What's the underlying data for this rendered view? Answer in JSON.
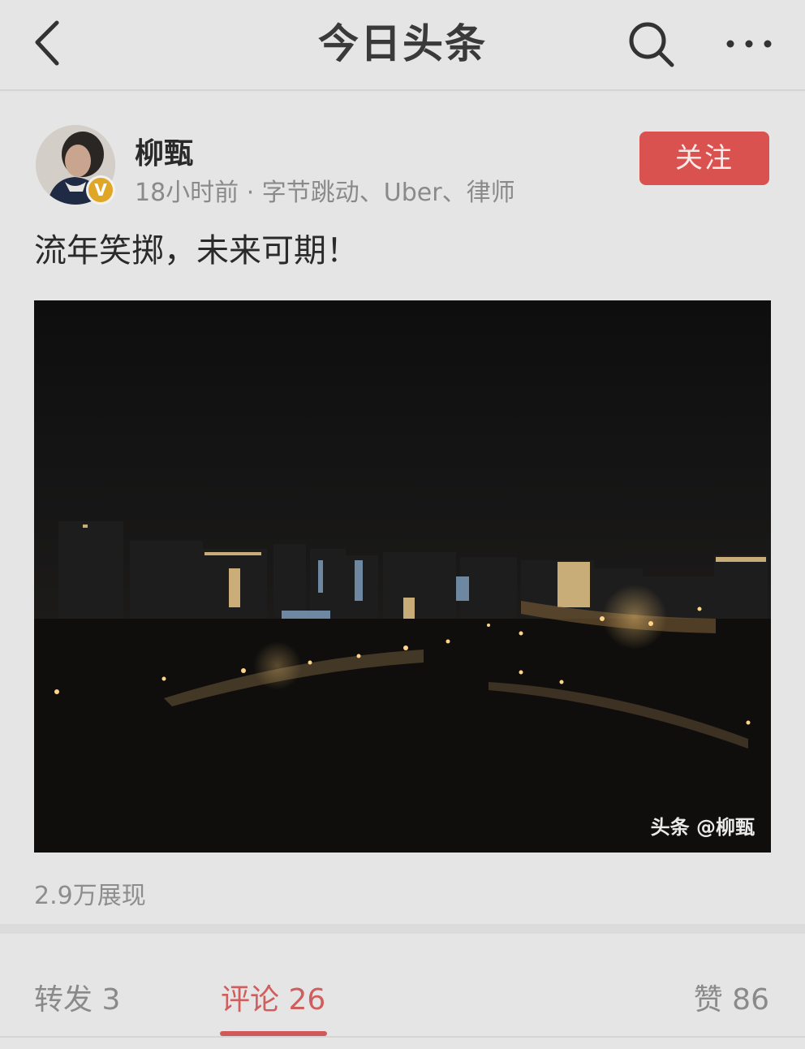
{
  "header": {
    "title": "今日头条",
    "back_icon": "chevron-left-icon",
    "search_icon": "search-icon",
    "more_icon": "more-horizontal-icon"
  },
  "post": {
    "author": {
      "name": "柳甄",
      "verified_badge": "V",
      "meta": "18小时前 · 字节跳动、Uber、律师"
    },
    "follow_label": "关注",
    "text": "流年笑掷，未来可期！",
    "image_watermark": "头条 @柳甄",
    "view_count": "2.9万展现"
  },
  "actions": {
    "repost": "转发 3",
    "comment": "评论 26",
    "like": "赞 86",
    "active_tab": "comment"
  },
  "colors": {
    "accent": "#d9524f",
    "background": "#e6e5e5",
    "muted_text": "#8a8a8a",
    "verified": "#e0a626"
  }
}
